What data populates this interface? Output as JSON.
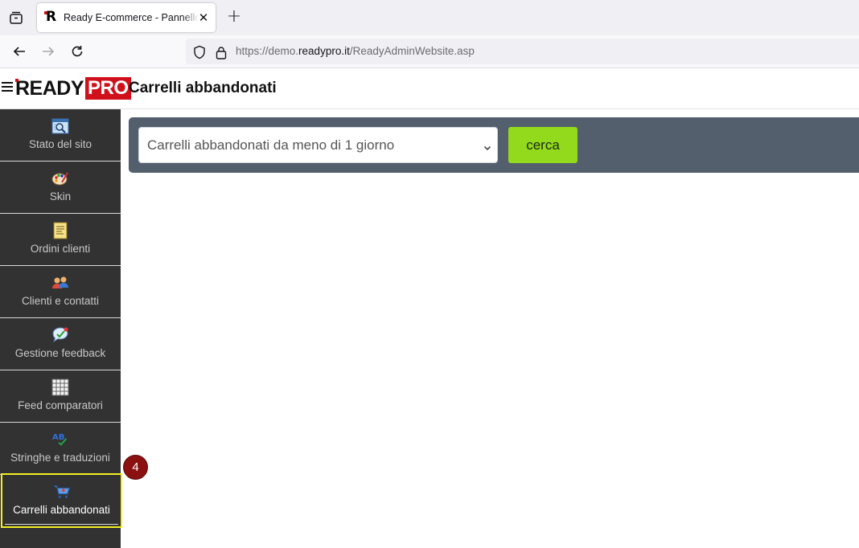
{
  "browser": {
    "tab_title": "Ready E-commerce - Pannello di controllo",
    "tab_close": "✕",
    "new_tab": "+",
    "url_prefix": "https://demo.",
    "url_domain": "readypro.it",
    "url_path": "/ReadyAdminWebsite.asp"
  },
  "header": {
    "logo_ready": "READY",
    "logo_pro": "PRO",
    "page_title": "Carrelli abbandonati"
  },
  "sidebar": {
    "items": [
      {
        "label": "Stato del sito",
        "icon": "site-status-icon"
      },
      {
        "label": "Skin",
        "icon": "palette-icon"
      },
      {
        "label": "Ordini clienti",
        "icon": "orders-document-icon"
      },
      {
        "label": "Clienti e contatti",
        "icon": "contacts-people-icon"
      },
      {
        "label": "Gestione feedback",
        "icon": "feedback-bubble-icon"
      },
      {
        "label": "Feed comparatori",
        "icon": "feed-grid-icon"
      },
      {
        "label": "Stringhe e traduzioni",
        "icon": "translation-ab-icon"
      },
      {
        "label": "Carrelli abbandonati",
        "icon": "shopping-cart-icon",
        "active": true
      }
    ]
  },
  "annotation": {
    "step": "4",
    "color": "#8b1010",
    "highlight_color": "#f5ef22"
  },
  "filter": {
    "period_value": "Carrelli abbandonati da meno di 1 giorno",
    "search_label": "cerca",
    "button_color": "#93d91c",
    "bar_color": "#535f6c"
  }
}
